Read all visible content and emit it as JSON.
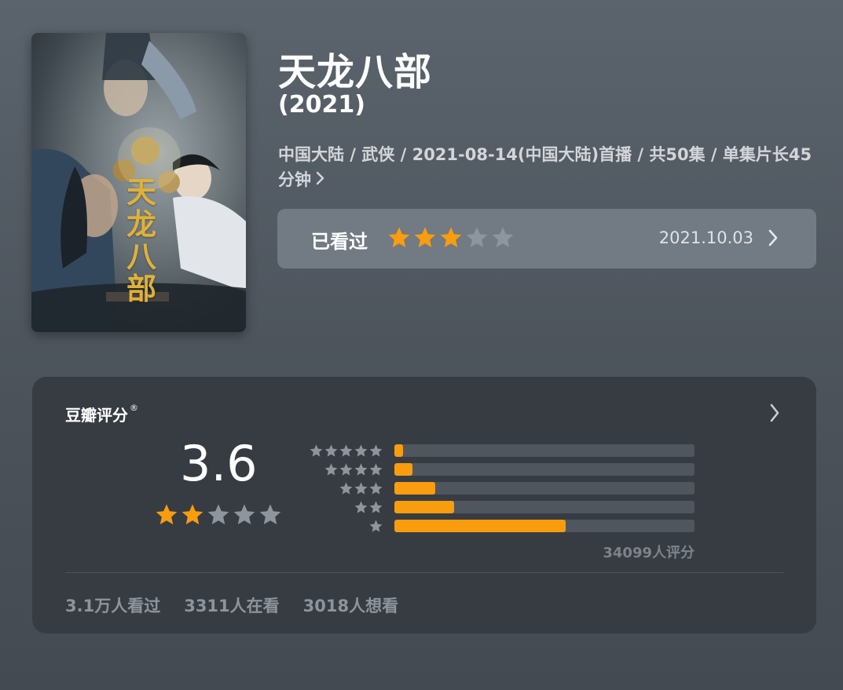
{
  "poster": {
    "title_text": "天龙八部"
  },
  "header": {
    "title": "天龙八部",
    "year": "(2021)",
    "meta": "中国大陆 / 武侠 / 2021-08-14(中国大陆)首播 / 共50集 / 单集片长45分钟",
    "meta_chevron": "›"
  },
  "watched": {
    "label": "已看过",
    "user_stars": 3,
    "max_stars": 5,
    "date": "2021.10.03"
  },
  "rating": {
    "heading": "豆瓣评分",
    "registered_mark": "®",
    "score": "3.6",
    "score_stars": 2,
    "distribution": [
      {
        "stars": 5,
        "percent": 3
      },
      {
        "stars": 4,
        "percent": 6
      },
      {
        "stars": 3,
        "percent": 13.5
      },
      {
        "stars": 2,
        "percent": 20
      },
      {
        "stars": 1,
        "percent": 57
      }
    ],
    "count_text": "34099人评分",
    "stats": [
      "3.1万人看过",
      "3311人在看",
      "3018人想看"
    ]
  },
  "colors": {
    "accent_orange": "#f99d0e",
    "star_gray": "#8e959c",
    "card_bg": "#373c43",
    "watched_bg": "#727a83"
  }
}
